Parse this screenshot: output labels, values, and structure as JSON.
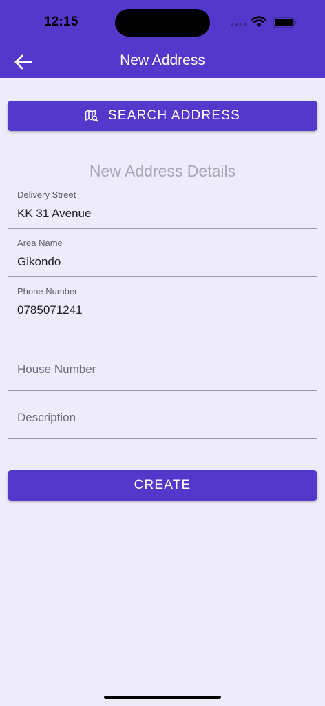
{
  "status_bar": {
    "time": "12:15"
  },
  "app_bar": {
    "title": "New Address",
    "back_icon": "arrow-left-icon"
  },
  "search_button": {
    "label": "SEARCH ADDRESS",
    "icon": "map-search-icon"
  },
  "section": {
    "title": "New Address Details"
  },
  "fields": [
    {
      "label": "Delivery Street",
      "value": "KK 31 Avenue"
    },
    {
      "label": "Area Name",
      "value": "Gikondo"
    },
    {
      "label": "Phone Number",
      "value": "0785071241"
    }
  ],
  "empty_fields": [
    {
      "placeholder": "House Number"
    },
    {
      "placeholder": "Description"
    }
  ],
  "create_button": {
    "label": "CREATE"
  },
  "colors": {
    "primary": "#5438CC",
    "background": "#EEEBFA",
    "muted_text": "#A8A6B3"
  }
}
